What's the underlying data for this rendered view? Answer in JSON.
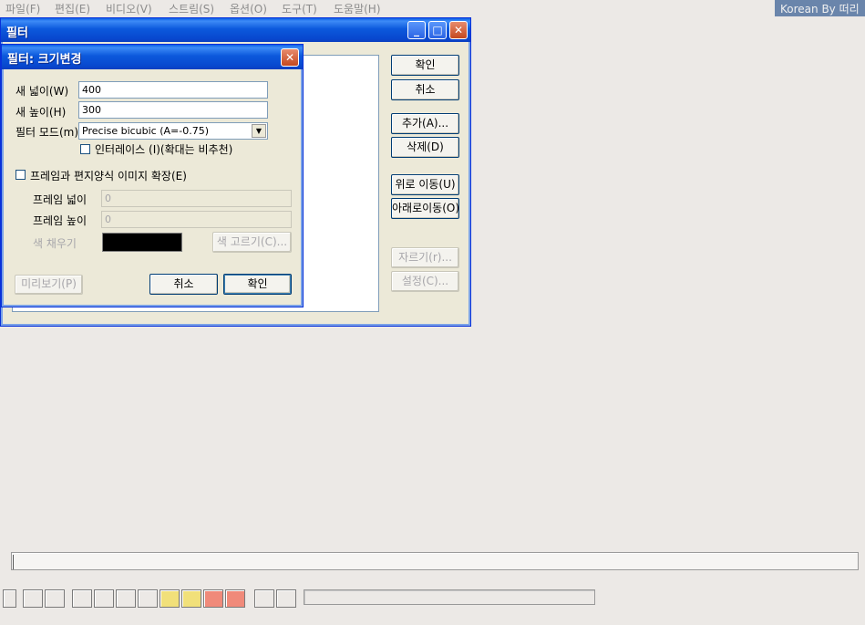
{
  "menu": {
    "items": [
      "파일(F)",
      "편집(E)",
      "비디오(V)",
      "스트림(S)",
      "옵션(O)",
      "도구(T)",
      "도움말(H)"
    ],
    "brand": "Korean By 떠리"
  },
  "filters_window": {
    "title": "필터",
    "buttons": {
      "ok": "확인",
      "cancel": "취소",
      "add": "추가(A)...",
      "delete": "삭제(D)",
      "move_up": "위로 이동(U)",
      "move_down": "아래로이동(O)",
      "crop": "자르기(r)...",
      "configure": "설정(C)..."
    }
  },
  "resize_dialog": {
    "title": "필터: 크기변경",
    "new_width_label": "새 넓이(W)",
    "new_width_value": "400",
    "new_height_label": "새 높이(H)",
    "new_height_value": "300",
    "filter_mode_label": "필터 모드(m)",
    "filter_mode_value": "Precise bicubic (A=-0.75)",
    "interlace_label": "인터레이스 (I)(확대는 비추천)",
    "expand_label": "프레임과 편지양식 이미지 확장(E)",
    "frame_width_label": "프레임 넓이",
    "frame_width_value": "0",
    "frame_height_label": "프레임 높이",
    "frame_height_value": "0",
    "fill_color_label": "색 채우기",
    "fill_color": "#000000",
    "pick_color_button": "색 고르기(C)...",
    "preview_button": "미리보기(P)",
    "cancel_button": "취소",
    "ok_button": "확인"
  },
  "toolbar": {
    "tools": [
      "stop-icon",
      "play-input-icon",
      "play-output-icon",
      "start-icon",
      "prev-key-icon",
      "next-key-icon",
      "end-icon",
      "scene-prev-icon",
      "scene-next-icon",
      "mark-in-icon",
      "mark-out-icon",
      "mark-left-icon",
      "mark-right-icon"
    ]
  }
}
